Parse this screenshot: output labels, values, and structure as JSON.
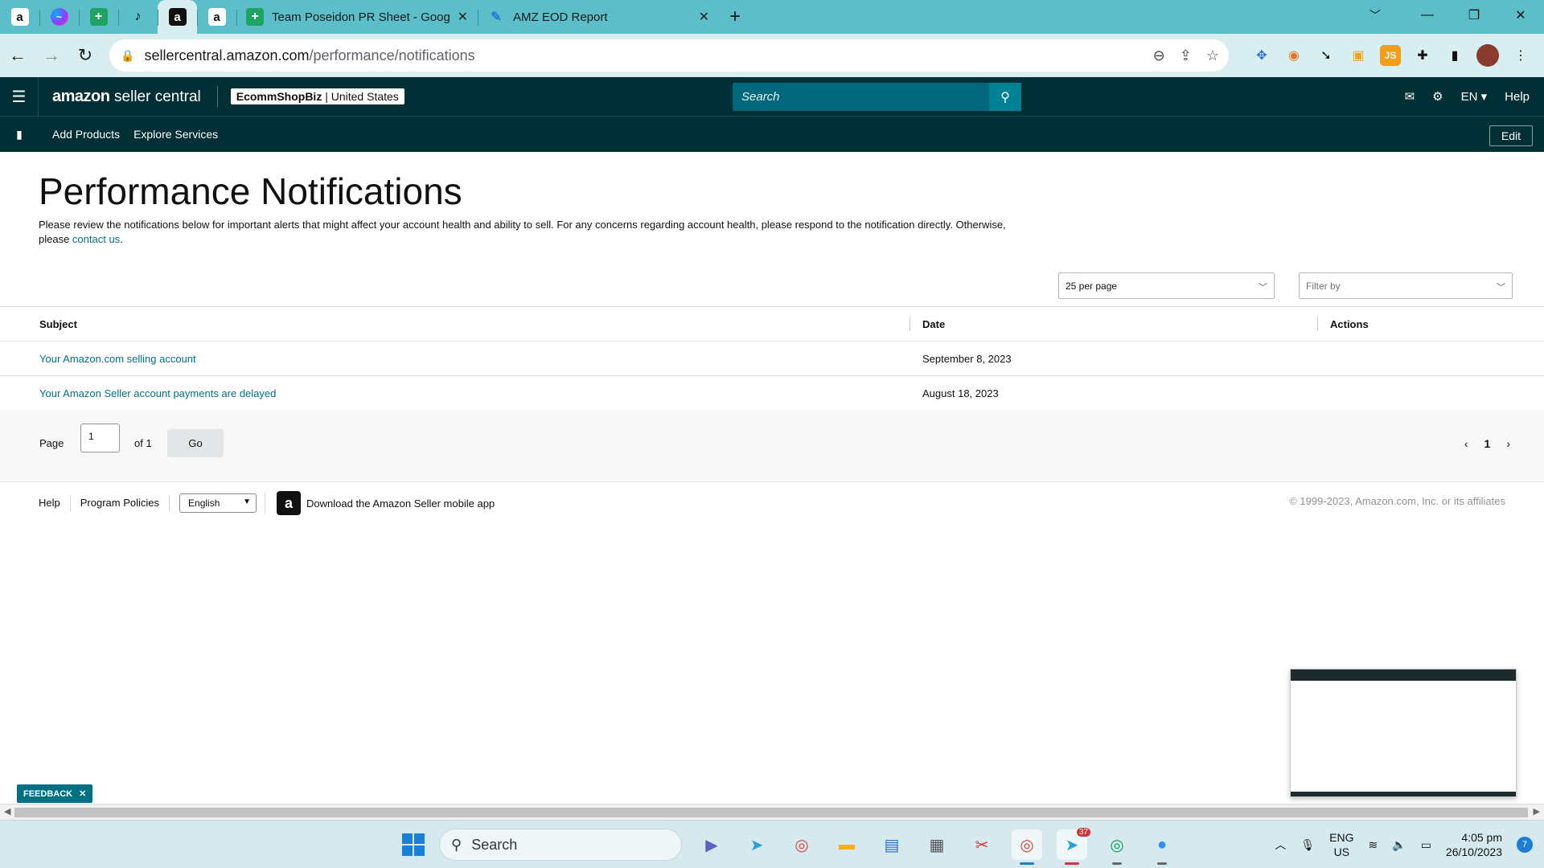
{
  "browser": {
    "pinned_tabs": [
      {
        "icon": "amazon-icon",
        "glyph": "a"
      },
      {
        "icon": "messenger-icon",
        "glyph": "~"
      },
      {
        "icon": "google-sheets-icon",
        "glyph": "+"
      },
      {
        "icon": "js-extension-icon",
        "glyph": "♪"
      },
      {
        "icon": "amazon-icon",
        "glyph": "a"
      },
      {
        "icon": "amazon-icon",
        "glyph": "a"
      }
    ],
    "tabs": [
      {
        "title": "Team Poseidon PR Sheet - Goog",
        "icon": "google-sheets-icon"
      },
      {
        "title": "AMZ EOD Report",
        "icon": "pen-icon"
      }
    ],
    "url_host": "sellercentral.amazon.com",
    "url_path": "/performance/notifications"
  },
  "header": {
    "logo_brand": "amazon",
    "logo_suffix": "seller central",
    "store_name": "EcommShopBiz",
    "store_sep": " | ",
    "store_region": "United States",
    "search_placeholder": "Search",
    "language": "EN",
    "help": "Help"
  },
  "nav": {
    "links": [
      "Add Products",
      "Explore Services"
    ],
    "edit": "Edit"
  },
  "page": {
    "title": "Performance Notifications",
    "intro_text": "Please review the notifications below for important alerts that might affect your account health and ability to sell. For any concerns regarding account health, please respond to the notification directly. Otherwise, please ",
    "intro_link": "contact us",
    "intro_end": ".",
    "per_page": "25 per page",
    "filter_placeholder": "Filter by"
  },
  "table": {
    "headers": {
      "subject": "Subject",
      "date": "Date",
      "actions": "Actions"
    },
    "rows": [
      {
        "subject": "Your Amazon.com selling account",
        "date": "September 8, 2023"
      },
      {
        "subject": "Your Amazon Seller account payments are delayed",
        "date": "August 18, 2023"
      }
    ]
  },
  "pager": {
    "label": "Page",
    "value": "1",
    "of": "of 1",
    "go": "Go",
    "current": "1"
  },
  "footer": {
    "help": "Help",
    "policies": "Program Policies",
    "language": "English",
    "app_text": "Download the Amazon Seller mobile app",
    "copyright": "© 1999-2023, Amazon.com, Inc. or its affiliates"
  },
  "feedback": "FEEDBACK",
  "taskbar": {
    "search": "Search",
    "telegram_badge": "37",
    "lang_top": "ENG",
    "lang_bottom": "US",
    "time": "4:05 pm",
    "date": "26/10/2023",
    "notifications": "7"
  },
  "colors": {
    "amazon_dark": "#002f36",
    "link": "#007185",
    "chrome_tab": "#5cbec8"
  }
}
